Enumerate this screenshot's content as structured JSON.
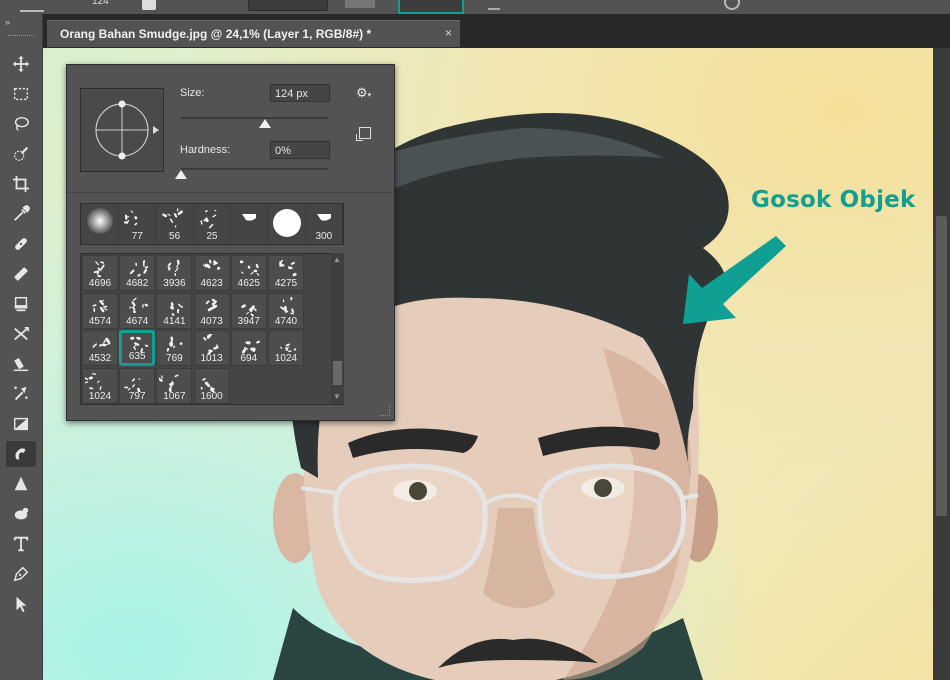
{
  "options_bar": {
    "brush_size": "124"
  },
  "document": {
    "tab_title": "Orang Bahan Smudge.jpg @ 24,1% (Layer 1, RGB/8#) *",
    "close_glyph": "×"
  },
  "annotation": {
    "text": "Gosok Objek",
    "color": "#0f9f93"
  },
  "brush_panel": {
    "size_label": "Size:",
    "size_value": "124 px",
    "size_level": 0.57,
    "hardness_label": "Hardness:",
    "hardness_value": "0%",
    "hardness_level": 0.0,
    "recent_brushes": [
      {
        "kind": "soft-round",
        "label": ""
      },
      {
        "kind": "splatter",
        "label": "77"
      },
      {
        "kind": "splatter",
        "label": "56"
      },
      {
        "kind": "splatter",
        "label": "25"
      },
      {
        "kind": "flat",
        "label": ""
      },
      {
        "kind": "hard-round",
        "label": ""
      },
      {
        "kind": "flat",
        "label": "300"
      }
    ],
    "brush_grid": [
      {
        "label": "4696",
        "selected": false
      },
      {
        "label": "4682",
        "selected": false
      },
      {
        "label": "3936",
        "selected": false
      },
      {
        "label": "4623",
        "selected": false
      },
      {
        "label": "4625",
        "selected": false
      },
      {
        "label": "4275",
        "selected": false
      },
      {
        "label": "4574",
        "selected": false
      },
      {
        "label": "4674",
        "selected": false
      },
      {
        "label": "4141",
        "selected": false
      },
      {
        "label": "4073",
        "selected": false
      },
      {
        "label": "3947",
        "selected": false
      },
      {
        "label": "4740",
        "selected": false
      },
      {
        "label": "4532",
        "selected": false
      },
      {
        "label": "635",
        "selected": true
      },
      {
        "label": "769",
        "selected": false
      },
      {
        "label": "1013",
        "selected": false
      },
      {
        "label": "694",
        "selected": false
      },
      {
        "label": "1024",
        "selected": false
      },
      {
        "label": "1024",
        "selected": false
      },
      {
        "label": "797",
        "selected": false
      },
      {
        "label": "1067",
        "selected": false
      },
      {
        "label": "1600",
        "selected": false
      }
    ],
    "selection_color": "#0f9f93"
  },
  "toolbar": {
    "tools": [
      {
        "name": "move-tool",
        "icon": "move-icon"
      },
      {
        "name": "marquee-tool",
        "icon": "marquee-icon"
      },
      {
        "name": "lasso-tool",
        "icon": "lasso-icon"
      },
      {
        "name": "quick-selection-tool",
        "icon": "quick-selection-icon"
      },
      {
        "name": "crop-tool",
        "icon": "crop-icon"
      },
      {
        "name": "eyedropper-tool",
        "icon": "eyedropper-icon"
      },
      {
        "name": "spot-healing-tool",
        "icon": "bandage-icon"
      },
      {
        "name": "brush-tool",
        "icon": "brush-icon"
      },
      {
        "name": "clone-stamp-tool",
        "icon": "stamp-icon"
      },
      {
        "name": "history-brush-tool",
        "icon": "history-brush-icon"
      },
      {
        "name": "eraser-tool",
        "icon": "eraser-icon"
      },
      {
        "name": "gradient-tool",
        "icon": "gradient-icon"
      },
      {
        "name": "smudge-tool",
        "icon": "smudge-icon"
      },
      {
        "name": "sharpen-tool",
        "icon": "sharpen-icon"
      },
      {
        "name": "dodge-tool",
        "icon": "dodge-icon"
      },
      {
        "name": "type-tool",
        "icon": "type-icon"
      },
      {
        "name": "pen-tool",
        "icon": "pen-icon"
      },
      {
        "name": "path-selection-tool",
        "icon": "arrow-icon"
      }
    ]
  }
}
